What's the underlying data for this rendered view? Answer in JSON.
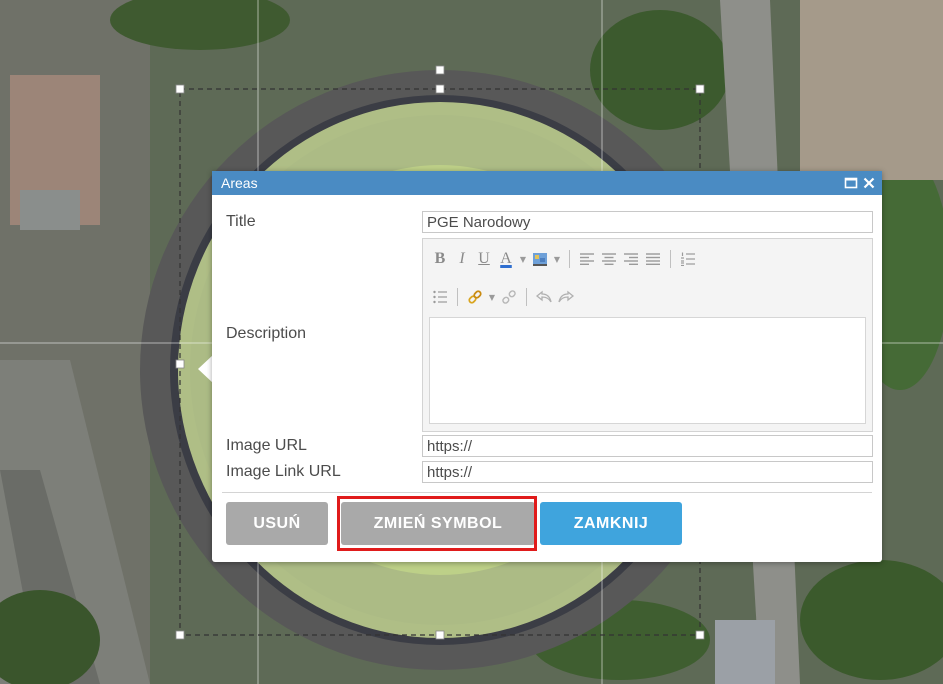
{
  "popup": {
    "title": "Areas",
    "fields": {
      "title_label": "Title",
      "title_value": "PGE Narodowy",
      "description_label": "Description",
      "description_value": "",
      "image_url_label": "Image URL",
      "image_url_value": "https://",
      "image_link_url_label": "Image Link URL",
      "image_link_url_value": "https://"
    },
    "toolbar": {
      "bold_label": "B",
      "italic_label": "I",
      "underline_label": "U",
      "font_color_label": "A"
    },
    "buttons": {
      "delete_label": "USUŃ",
      "change_symbol_label": "ZMIEŃ SYMBOL",
      "close_label": "ZAMKNIJ"
    }
  },
  "colors": {
    "header": "#4a8bc3",
    "close_button": "#3fa4dd",
    "gray_button": "#a9a9a9",
    "highlight": "#e01b1b",
    "stadium_fill": "#d7ea9c"
  },
  "icons": {
    "maximize": "maximize-icon",
    "close": "close-icon"
  }
}
